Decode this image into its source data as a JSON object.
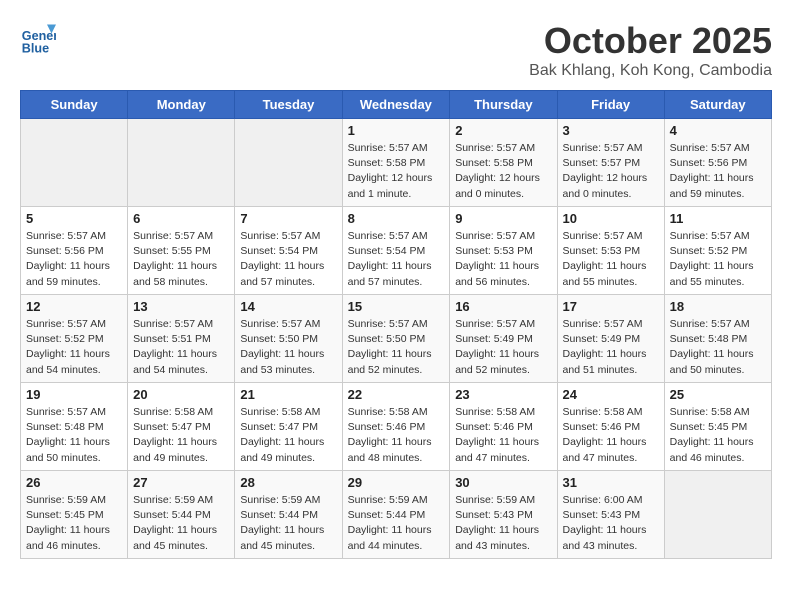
{
  "header": {
    "logo_line1": "General",
    "logo_line2": "Blue",
    "month_title": "October 2025",
    "subtitle": "Bak Khlang, Koh Kong, Cambodia"
  },
  "days_of_week": [
    "Sunday",
    "Monday",
    "Tuesday",
    "Wednesday",
    "Thursday",
    "Friday",
    "Saturday"
  ],
  "weeks": [
    [
      {
        "day": "",
        "info": ""
      },
      {
        "day": "",
        "info": ""
      },
      {
        "day": "",
        "info": ""
      },
      {
        "day": "1",
        "info": "Sunrise: 5:57 AM\nSunset: 5:58 PM\nDaylight: 12 hours\nand 1 minute."
      },
      {
        "day": "2",
        "info": "Sunrise: 5:57 AM\nSunset: 5:58 PM\nDaylight: 12 hours\nand 0 minutes."
      },
      {
        "day": "3",
        "info": "Sunrise: 5:57 AM\nSunset: 5:57 PM\nDaylight: 12 hours\nand 0 minutes."
      },
      {
        "day": "4",
        "info": "Sunrise: 5:57 AM\nSunset: 5:56 PM\nDaylight: 11 hours\nand 59 minutes."
      }
    ],
    [
      {
        "day": "5",
        "info": "Sunrise: 5:57 AM\nSunset: 5:56 PM\nDaylight: 11 hours\nand 59 minutes."
      },
      {
        "day": "6",
        "info": "Sunrise: 5:57 AM\nSunset: 5:55 PM\nDaylight: 11 hours\nand 58 minutes."
      },
      {
        "day": "7",
        "info": "Sunrise: 5:57 AM\nSunset: 5:54 PM\nDaylight: 11 hours\nand 57 minutes."
      },
      {
        "day": "8",
        "info": "Sunrise: 5:57 AM\nSunset: 5:54 PM\nDaylight: 11 hours\nand 57 minutes."
      },
      {
        "day": "9",
        "info": "Sunrise: 5:57 AM\nSunset: 5:53 PM\nDaylight: 11 hours\nand 56 minutes."
      },
      {
        "day": "10",
        "info": "Sunrise: 5:57 AM\nSunset: 5:53 PM\nDaylight: 11 hours\nand 55 minutes."
      },
      {
        "day": "11",
        "info": "Sunrise: 5:57 AM\nSunset: 5:52 PM\nDaylight: 11 hours\nand 55 minutes."
      }
    ],
    [
      {
        "day": "12",
        "info": "Sunrise: 5:57 AM\nSunset: 5:52 PM\nDaylight: 11 hours\nand 54 minutes."
      },
      {
        "day": "13",
        "info": "Sunrise: 5:57 AM\nSunset: 5:51 PM\nDaylight: 11 hours\nand 54 minutes."
      },
      {
        "day": "14",
        "info": "Sunrise: 5:57 AM\nSunset: 5:50 PM\nDaylight: 11 hours\nand 53 minutes."
      },
      {
        "day": "15",
        "info": "Sunrise: 5:57 AM\nSunset: 5:50 PM\nDaylight: 11 hours\nand 52 minutes."
      },
      {
        "day": "16",
        "info": "Sunrise: 5:57 AM\nSunset: 5:49 PM\nDaylight: 11 hours\nand 52 minutes."
      },
      {
        "day": "17",
        "info": "Sunrise: 5:57 AM\nSunset: 5:49 PM\nDaylight: 11 hours\nand 51 minutes."
      },
      {
        "day": "18",
        "info": "Sunrise: 5:57 AM\nSunset: 5:48 PM\nDaylight: 11 hours\nand 50 minutes."
      }
    ],
    [
      {
        "day": "19",
        "info": "Sunrise: 5:57 AM\nSunset: 5:48 PM\nDaylight: 11 hours\nand 50 minutes."
      },
      {
        "day": "20",
        "info": "Sunrise: 5:58 AM\nSunset: 5:47 PM\nDaylight: 11 hours\nand 49 minutes."
      },
      {
        "day": "21",
        "info": "Sunrise: 5:58 AM\nSunset: 5:47 PM\nDaylight: 11 hours\nand 49 minutes."
      },
      {
        "day": "22",
        "info": "Sunrise: 5:58 AM\nSunset: 5:46 PM\nDaylight: 11 hours\nand 48 minutes."
      },
      {
        "day": "23",
        "info": "Sunrise: 5:58 AM\nSunset: 5:46 PM\nDaylight: 11 hours\nand 47 minutes."
      },
      {
        "day": "24",
        "info": "Sunrise: 5:58 AM\nSunset: 5:46 PM\nDaylight: 11 hours\nand 47 minutes."
      },
      {
        "day": "25",
        "info": "Sunrise: 5:58 AM\nSunset: 5:45 PM\nDaylight: 11 hours\nand 46 minutes."
      }
    ],
    [
      {
        "day": "26",
        "info": "Sunrise: 5:59 AM\nSunset: 5:45 PM\nDaylight: 11 hours\nand 46 minutes."
      },
      {
        "day": "27",
        "info": "Sunrise: 5:59 AM\nSunset: 5:44 PM\nDaylight: 11 hours\nand 45 minutes."
      },
      {
        "day": "28",
        "info": "Sunrise: 5:59 AM\nSunset: 5:44 PM\nDaylight: 11 hours\nand 45 minutes."
      },
      {
        "day": "29",
        "info": "Sunrise: 5:59 AM\nSunset: 5:44 PM\nDaylight: 11 hours\nand 44 minutes."
      },
      {
        "day": "30",
        "info": "Sunrise: 5:59 AM\nSunset: 5:43 PM\nDaylight: 11 hours\nand 43 minutes."
      },
      {
        "day": "31",
        "info": "Sunrise: 6:00 AM\nSunset: 5:43 PM\nDaylight: 11 hours\nand 43 minutes."
      },
      {
        "day": "",
        "info": ""
      }
    ]
  ]
}
